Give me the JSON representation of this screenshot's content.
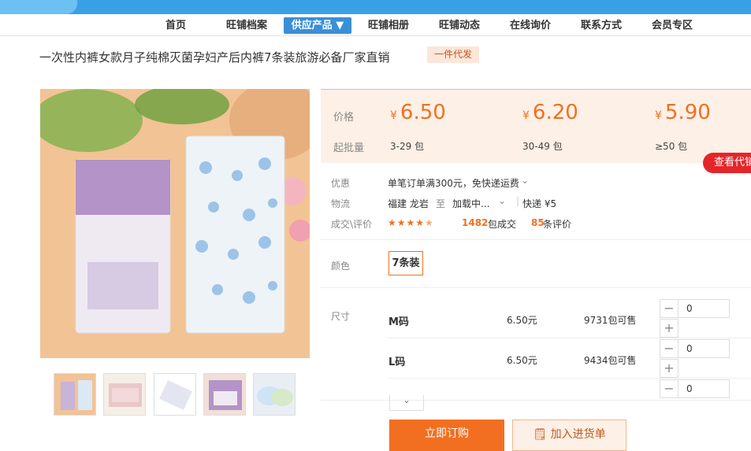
{
  "nav": {
    "items": [
      "首页",
      "旺铺档案",
      "供应产品 ▼",
      "旺铺相册",
      "旺铺动态",
      "在线询价",
      "联系方式",
      "会员专区"
    ]
  },
  "product": {
    "title": "一次性内裤女款月子纯棉灭菌孕妇产后内裤7条装旅游必备厂家直销",
    "tag": "一件代发"
  },
  "price": {
    "label": "价格",
    "batch_label": "起批量",
    "currency": "¥",
    "tiers": [
      {
        "price": "6.50",
        "qty": "3-29 包"
      },
      {
        "price": "6.20",
        "qty": "30-49 包"
      },
      {
        "price": "5.90",
        "qty": "≥50 包"
      }
    ]
  },
  "check_agent_button": "查看代销",
  "promo": {
    "label": "优惠",
    "value": "单笔订单满300元，免快递运费"
  },
  "logistics": {
    "label": "物流",
    "from": "福建 龙岩",
    "to_word": "至",
    "to": "加载中...",
    "method": "快递 ¥5"
  },
  "deal": {
    "label": "成交\\评价",
    "sold": "1482",
    "sold_unit": "包成交",
    "reviews": "85",
    "reviews_unit": "条评价",
    "rating": 4.5
  },
  "color": {
    "label": "颜色",
    "selected": "7条装"
  },
  "size": {
    "label": "尺寸",
    "rows": [
      {
        "name": "M码",
        "price": "6.50元",
        "stock": "9731包可售",
        "qty": "0"
      },
      {
        "name": "L码",
        "price": "6.50元",
        "stock": "9434包可售",
        "qty": "0"
      },
      {
        "name": "",
        "price": "",
        "stock": "",
        "qty": "0"
      }
    ]
  },
  "actions": {
    "order": "立即订购",
    "cart": "加入进货单"
  },
  "colors": {
    "accent": "#f26f21",
    "nav_active": "#3a8fd6",
    "top_bar": "#3aa0e6",
    "red_button": "#e4262a"
  }
}
